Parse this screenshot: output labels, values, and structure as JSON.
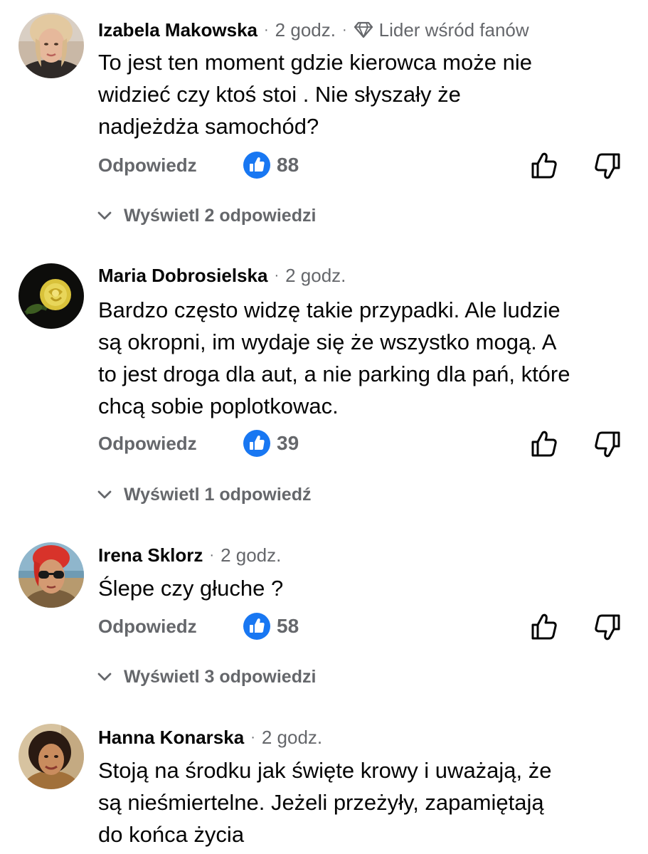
{
  "colors": {
    "text_primary": "#050505",
    "text_secondary": "#65676b",
    "reaction_blue": "#1877f2"
  },
  "comments": [
    {
      "author": "Izabela Makowska",
      "time": "2 godz.",
      "badge": "Lider wśród fanów",
      "badge_icon": "diamond-icon",
      "lines": [
        "To jest ten moment gdzie kierowca może nie",
        "widzieć czy ktoś stoi . Nie słyszały że",
        "nadjeżdża samochód?"
      ],
      "reply_label": "Odpowiedz",
      "reaction_icon": "thumbs-up-reaction-icon",
      "reaction_count": "88",
      "replies_label": "Wyświetl 2 odpowiedzi"
    },
    {
      "author": "Maria Dobrosielska",
      "time": "2 godz.",
      "lines": [
        "Bardzo często widzę takie przypadki. Ale ludzie",
        "są okropni, im wydaje się że wszystko mogą. A",
        "to jest droga dla aut, a nie parking dla pań, które",
        "chcą sobie poplotkowac."
      ],
      "reply_label": "Odpowiedz",
      "reaction_icon": "thumbs-up-reaction-icon",
      "reaction_count": "39",
      "replies_label": "Wyświetl 1 odpowiedź"
    },
    {
      "author": "Irena Sklorz",
      "time": "2 godz.",
      "lines": [
        "Ślepe czy głuche ?"
      ],
      "reply_label": "Odpowiedz",
      "reaction_icon": "thumbs-up-reaction-icon",
      "reaction_count": "58",
      "replies_label": "Wyświetl 3 odpowiedzi"
    },
    {
      "author": "Hanna Konarska",
      "time": "2 godz.",
      "lines": [
        "Stoją na środku jak święte krowy i uważają, że",
        "są nieśmiertelne. Jeżeli przeżyły, zapamiętają",
        "do końca życia"
      ]
    }
  ]
}
